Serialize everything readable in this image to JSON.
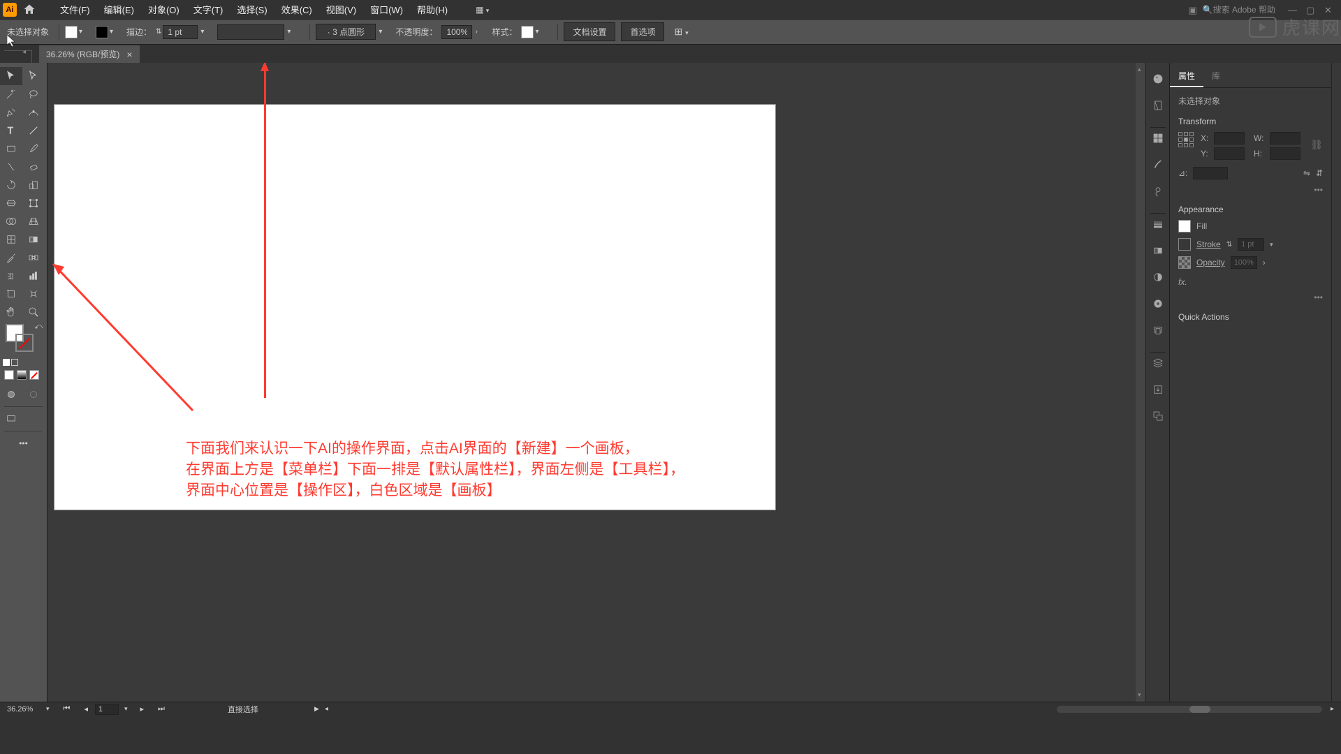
{
  "menu": {
    "file": "文件(F)",
    "edit": "编辑(E)",
    "object": "对象(O)",
    "type": "文字(T)",
    "select": "选择(S)",
    "effect": "效果(C)",
    "view": "视图(V)",
    "window": "窗口(W)",
    "help": "帮助(H)"
  },
  "search": {
    "placeholder": "搜索 Adobe 帮助"
  },
  "control": {
    "noselect": "未选择对象",
    "stroke_label": "描边：",
    "stroke_val": "1 pt",
    "brush_label": "· 3 点圆形",
    "opacity_label": "不透明度：",
    "opacity_val": "100%",
    "style_label": "样式：",
    "docsetup": "文档设置",
    "prefs": "首选项"
  },
  "doc_tab": {
    "title": "36.26% (RGB/预览)"
  },
  "annotation": {
    "line1": "下面我们来认识一下AI的操作界面，点击AI界面的【新建】一个画板，",
    "line2": "在界面上方是【菜单栏】下面一排是【默认属性栏】，界面左侧是【工具栏】，",
    "line3": "界面中心位置是【操作区】，白色区域是【画板】"
  },
  "panel": {
    "tab_props": "属性",
    "tab_lib": "库",
    "noselect": "未选择对象",
    "transform": "Transform",
    "x": "X:",
    "y": "Y:",
    "w": "W:",
    "h": "H:",
    "angle": "⊿:",
    "appearance": "Appearance",
    "fill": "Fill",
    "stroke": "Stroke",
    "stroke_val": "1 pt",
    "opacity": "Opacity",
    "opacity_val": "100%",
    "fx": "fx.",
    "quick": "Quick Actions"
  },
  "status": {
    "zoom": "36.26%",
    "page": "1",
    "tool": "直接选择"
  },
  "watermark": "虎课网"
}
